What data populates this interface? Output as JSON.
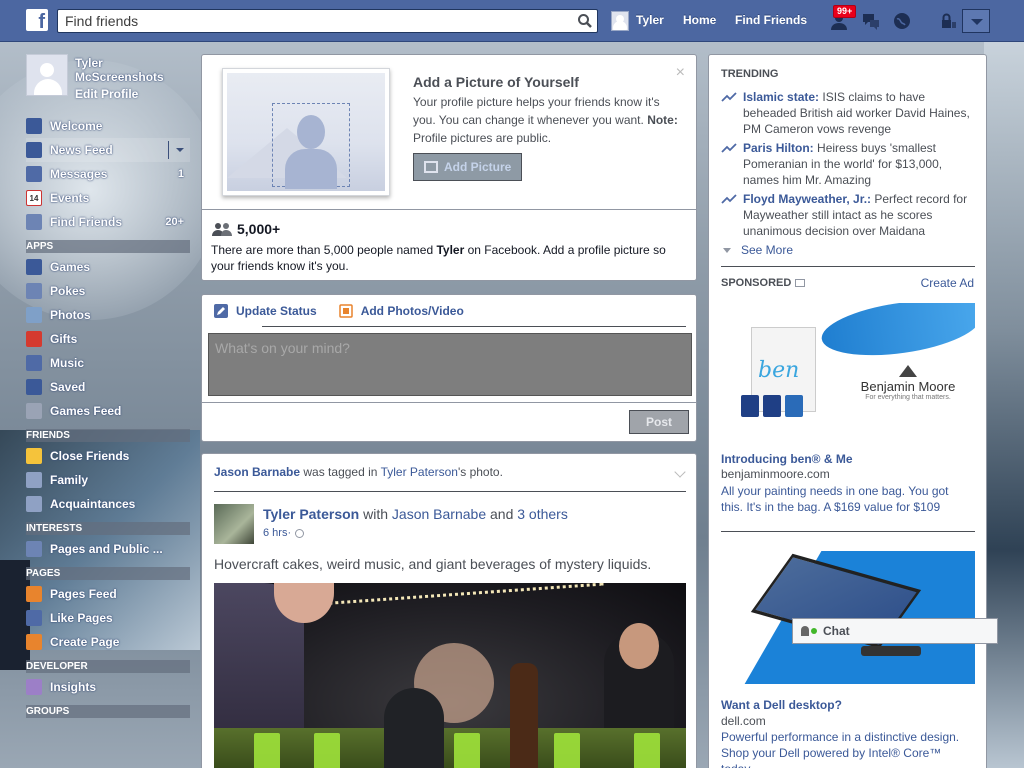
{
  "colors": {
    "brand": "#4c67a1",
    "link": "#3b5998",
    "badge": "#e9001a",
    "online": "#42b72a"
  },
  "topbar": {
    "logo": "f",
    "search_placeholder": "Find friends",
    "user_name": "Tyler",
    "home_label": "Home",
    "find_friends_label": "Find Friends",
    "notification_count": "99+"
  },
  "sidebar": {
    "profile_name": "Tyler McScreenshots",
    "edit_profile": "Edit Profile",
    "main_items": [
      {
        "label": "Welcome",
        "icon": "facebook-icon",
        "count": ""
      },
      {
        "label": "News Feed",
        "icon": "news-feed-icon",
        "count": ""
      },
      {
        "label": "Messages",
        "icon": "messages-icon",
        "count": "1"
      },
      {
        "label": "Events",
        "icon": "calendar-icon",
        "count": "",
        "icon_text": "14"
      },
      {
        "label": "Find Friends",
        "icon": "find-friends-icon",
        "count": "20+"
      }
    ],
    "sections": {
      "apps": "APPS",
      "friends": "FRIENDS",
      "interests": "INTERESTS",
      "pages": "PAGES",
      "developer": "DEVELOPER",
      "groups": "GROUPS"
    },
    "apps_items": [
      {
        "label": "Games",
        "icon": "games-icon"
      },
      {
        "label": "Pokes",
        "icon": "pokes-icon"
      },
      {
        "label": "Photos",
        "icon": "photos-icon"
      },
      {
        "label": "Gifts",
        "icon": "gift-icon"
      },
      {
        "label": "Music",
        "icon": "music-icon"
      },
      {
        "label": "Saved",
        "icon": "saved-icon"
      },
      {
        "label": "Games Feed",
        "icon": "games-feed-icon"
      }
    ],
    "friends_items": [
      {
        "label": "Close Friends",
        "icon": "star-icon"
      },
      {
        "label": "Family",
        "icon": "family-icon"
      },
      {
        "label": "Acquaintances",
        "icon": "acquaintances-icon"
      }
    ],
    "interests_items": [
      {
        "label": "Pages and Public ...",
        "icon": "pages-feed-icon"
      }
    ],
    "pages_items": [
      {
        "label": "Pages Feed",
        "icon": "pages-feed-icon"
      },
      {
        "label": "Like Pages",
        "icon": "like-icon"
      },
      {
        "label": "Create Page",
        "icon": "create-page-icon"
      }
    ],
    "developer_items": [
      {
        "label": "Insights",
        "icon": "insights-icon"
      }
    ]
  },
  "profile_prompt": {
    "title": "Add a Picture of Yourself",
    "body": "Your profile picture helps your friends know it's you. You can change it whenever you want.",
    "note_label": "Note:",
    "note_text": " Profile pictures are public.",
    "button": "Add Picture",
    "close": "×",
    "count": "5,000+",
    "count_text_a": "There are more than 5,000 people named ",
    "count_name": "Tyler",
    "count_text_b": " on Facebook. Add a profile picture so your friends know it's you."
  },
  "composer": {
    "tab_status": "Update Status",
    "tab_photos": "Add Photos/Video",
    "placeholder": "What's on your mind?",
    "post_button": "Post"
  },
  "story": {
    "tag_actor": "Jason Barnabe",
    "tag_mid": " was tagged in ",
    "tag_owner": "Tyler Paterson",
    "tag_end": "'s photo.",
    "author": "Tyler Paterson",
    "with": " with ",
    "with_name": "Jason Barnabe",
    "and": " and ",
    "others": "3 others",
    "time": "6 hrs",
    "time_sep": " · ",
    "text": "Hovercraft cakes, weird music, and giant beverages of mystery liquids."
  },
  "trending": {
    "header": "TRENDING",
    "items": [
      {
        "topic": "Islamic state:",
        "text": " ISIS claims to have beheaded British aid worker David Haines, PM Cameron vows revenge"
      },
      {
        "topic": "Paris Hilton:",
        "text": " Heiress buys 'smallest Pomeranian in the world' for $13,000, names him Mr. Amazing"
      },
      {
        "topic": "Floyd Mayweather, Jr.:",
        "text": " Perfect record for Mayweather still intact as he scores unanimous decision over Maidana"
      }
    ],
    "see_more": "See More"
  },
  "sponsored": {
    "header": "SPONSORED",
    "create_ad": "Create Ad",
    "ads": [
      {
        "title": "Introducing ben® & Me",
        "domain": "benjaminmoore.com",
        "desc": "All your painting needs in one bag. You got this. It's in the bag. A $169 value for $109",
        "img_brand": "Benjamin Moore",
        "img_tagline": "For everything that matters.",
        "img_bag": "ben"
      },
      {
        "title": "Want a Dell desktop?",
        "domain": "dell.com",
        "desc": "Powerful performance in a distinctive design. Shop your Dell powered by Intel® Core™ today."
      }
    ]
  },
  "chat": {
    "label": "Chat"
  }
}
